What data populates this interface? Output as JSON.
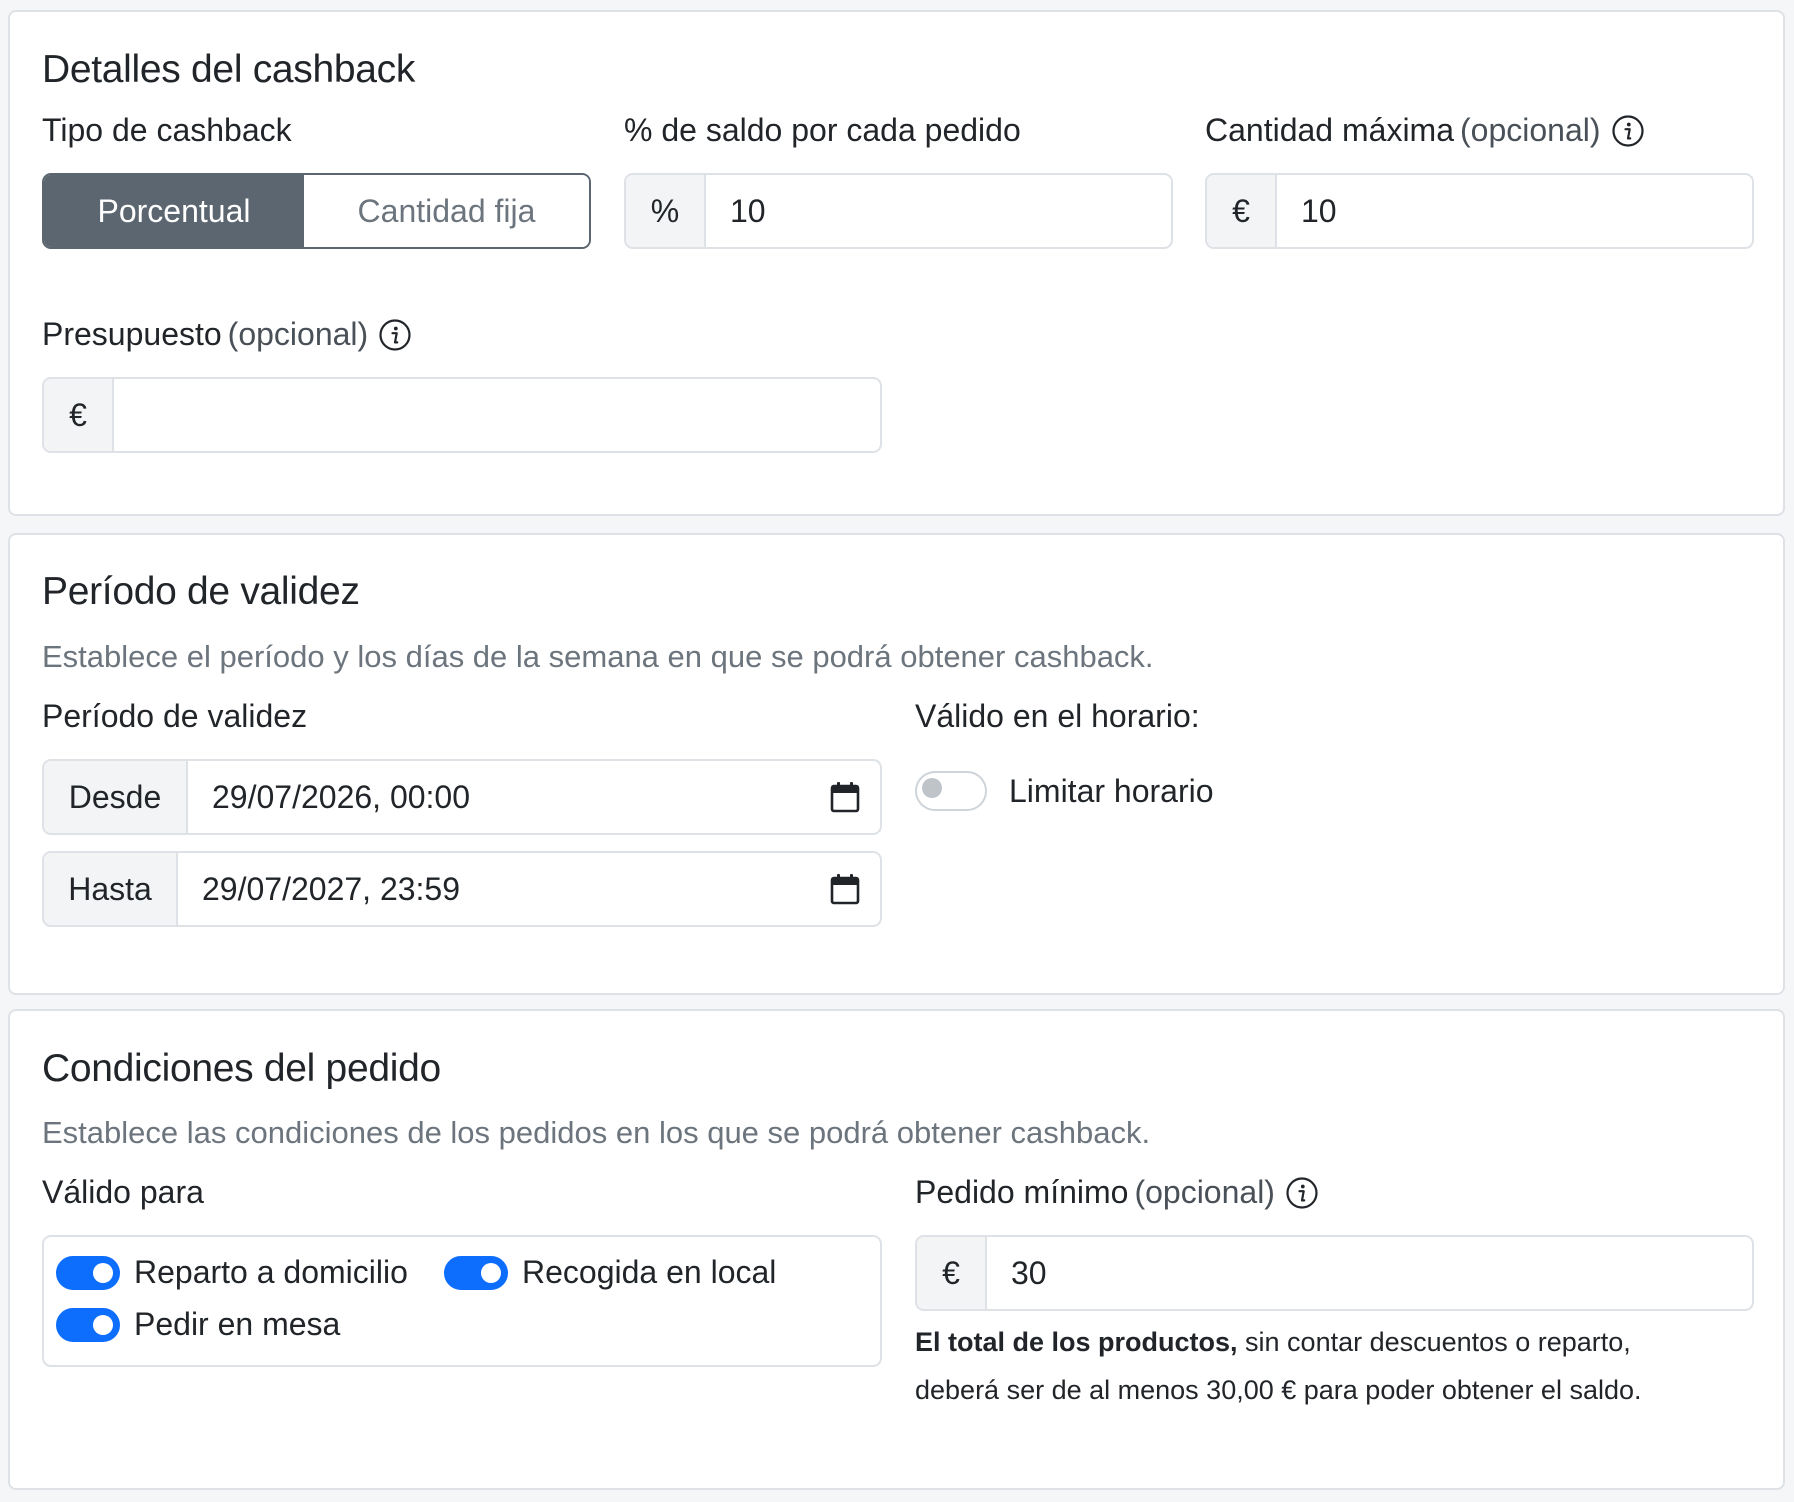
{
  "cashback": {
    "title": "Detalles del cashback",
    "type_label": "Tipo de cashback",
    "type_options": [
      "Porcentual",
      "Cantidad fija"
    ],
    "type_selected": "Porcentual",
    "percent_label": "% de saldo por cada pedido",
    "percent_addon": "%",
    "percent_value": "10",
    "max_label": "Cantidad máxima",
    "max_optional": "(opcional)",
    "max_addon": "€",
    "max_value": "10",
    "budget_label": "Presupuesto",
    "budget_optional": "(opcional)",
    "budget_addon": "€",
    "budget_value": ""
  },
  "validity": {
    "title": "Período de validez",
    "subtitle": "Establece el período y los días de la semana en que se podrá obtener cashback.",
    "period_label": "Período de validez",
    "from_addon": "Desde",
    "from_value": "29/07/2026, 00:00",
    "to_addon": "Hasta",
    "to_value": "29/07/2027, 23:59",
    "schedule_label": "Válido en el horario:",
    "limit_schedule_label": "Limitar horario",
    "limit_schedule_on": false
  },
  "conditions": {
    "title": "Condiciones del pedido",
    "subtitle": "Establece las condiciones de los pedidos en los que se podrá obtener cashback.",
    "valid_for_label": "Válido para",
    "options": [
      {
        "label": "Reparto a domicilio",
        "on": true
      },
      {
        "label": "Recogida en local",
        "on": true
      },
      {
        "label": "Pedir en mesa",
        "on": true
      }
    ],
    "min_order_label": "Pedido mínimo",
    "min_order_optional": "(opcional)",
    "min_order_addon": "€",
    "min_order_value": "30",
    "help_bold": "El total de los productos,",
    "help_line1": " sin contar descuentos o reparto,",
    "help_line2": "deberá ser de al menos 30,00 € para poder obtener el saldo."
  },
  "icons": {
    "info": "info-circle-icon",
    "calendar": "calendar-icon"
  },
  "colors": {
    "accent": "#0d6efd",
    "segment_active": "#5c6670",
    "muted_text": "#6c757d",
    "border": "#dee2e6"
  }
}
